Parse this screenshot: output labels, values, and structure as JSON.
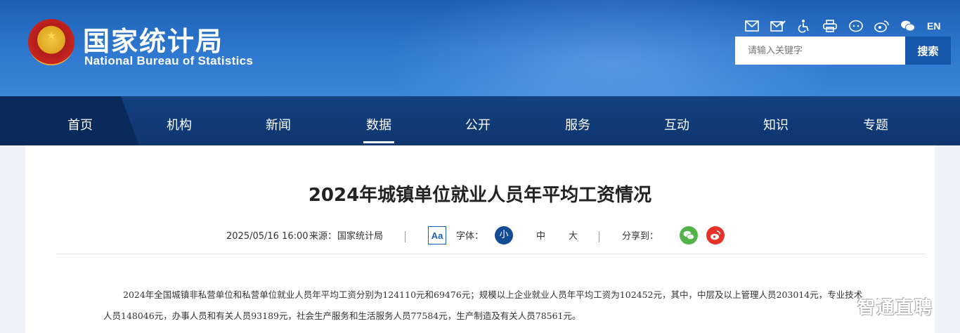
{
  "header": {
    "logo_cn": "国家统计局",
    "logo_en": "National Bureau of Statistics",
    "tools": [
      "mail-icon",
      "email-edit-icon",
      "accessibility-icon",
      "print-icon",
      "mini-program-icon",
      "weibo-icon",
      "wechat-icon"
    ],
    "lang": "EN",
    "search": {
      "placeholder": "请输入关键字",
      "button": "搜索"
    }
  },
  "nav": {
    "items": [
      "首页",
      "机构",
      "新闻",
      "数据",
      "公开",
      "服务",
      "互动",
      "知识",
      "专题"
    ],
    "active": "数据"
  },
  "article": {
    "title": "2024年城镇单位就业人员年平均工资情况",
    "date": "2025/05/16 16:00",
    "source_label": "来源：",
    "source": "国家统计局",
    "aa": "Aa",
    "font_label": "字体：",
    "font_sizes": [
      "小",
      "中",
      "大"
    ],
    "share_label": "分享到：",
    "body_line1": "2024年全国城镇非私营单位和私营单位就业人员年平均工资分别为124110元和69476元；规模以上企业就业人员年平均工资为102452元，其中，中层及以上管理人员203014元，专业技术",
    "body_line2": "人员148046元，办事人员和有关人员93189元，社会生产服务和生活服务人员77584元，生产制造及有关人员78561元。"
  },
  "watermark": "智通直聘",
  "colors": {
    "header_blue": "#2f78cf",
    "nav_blue": "#13417f",
    "accent": "#1557a8",
    "wechat": "#51b448",
    "weibo": "#e6332a"
  }
}
